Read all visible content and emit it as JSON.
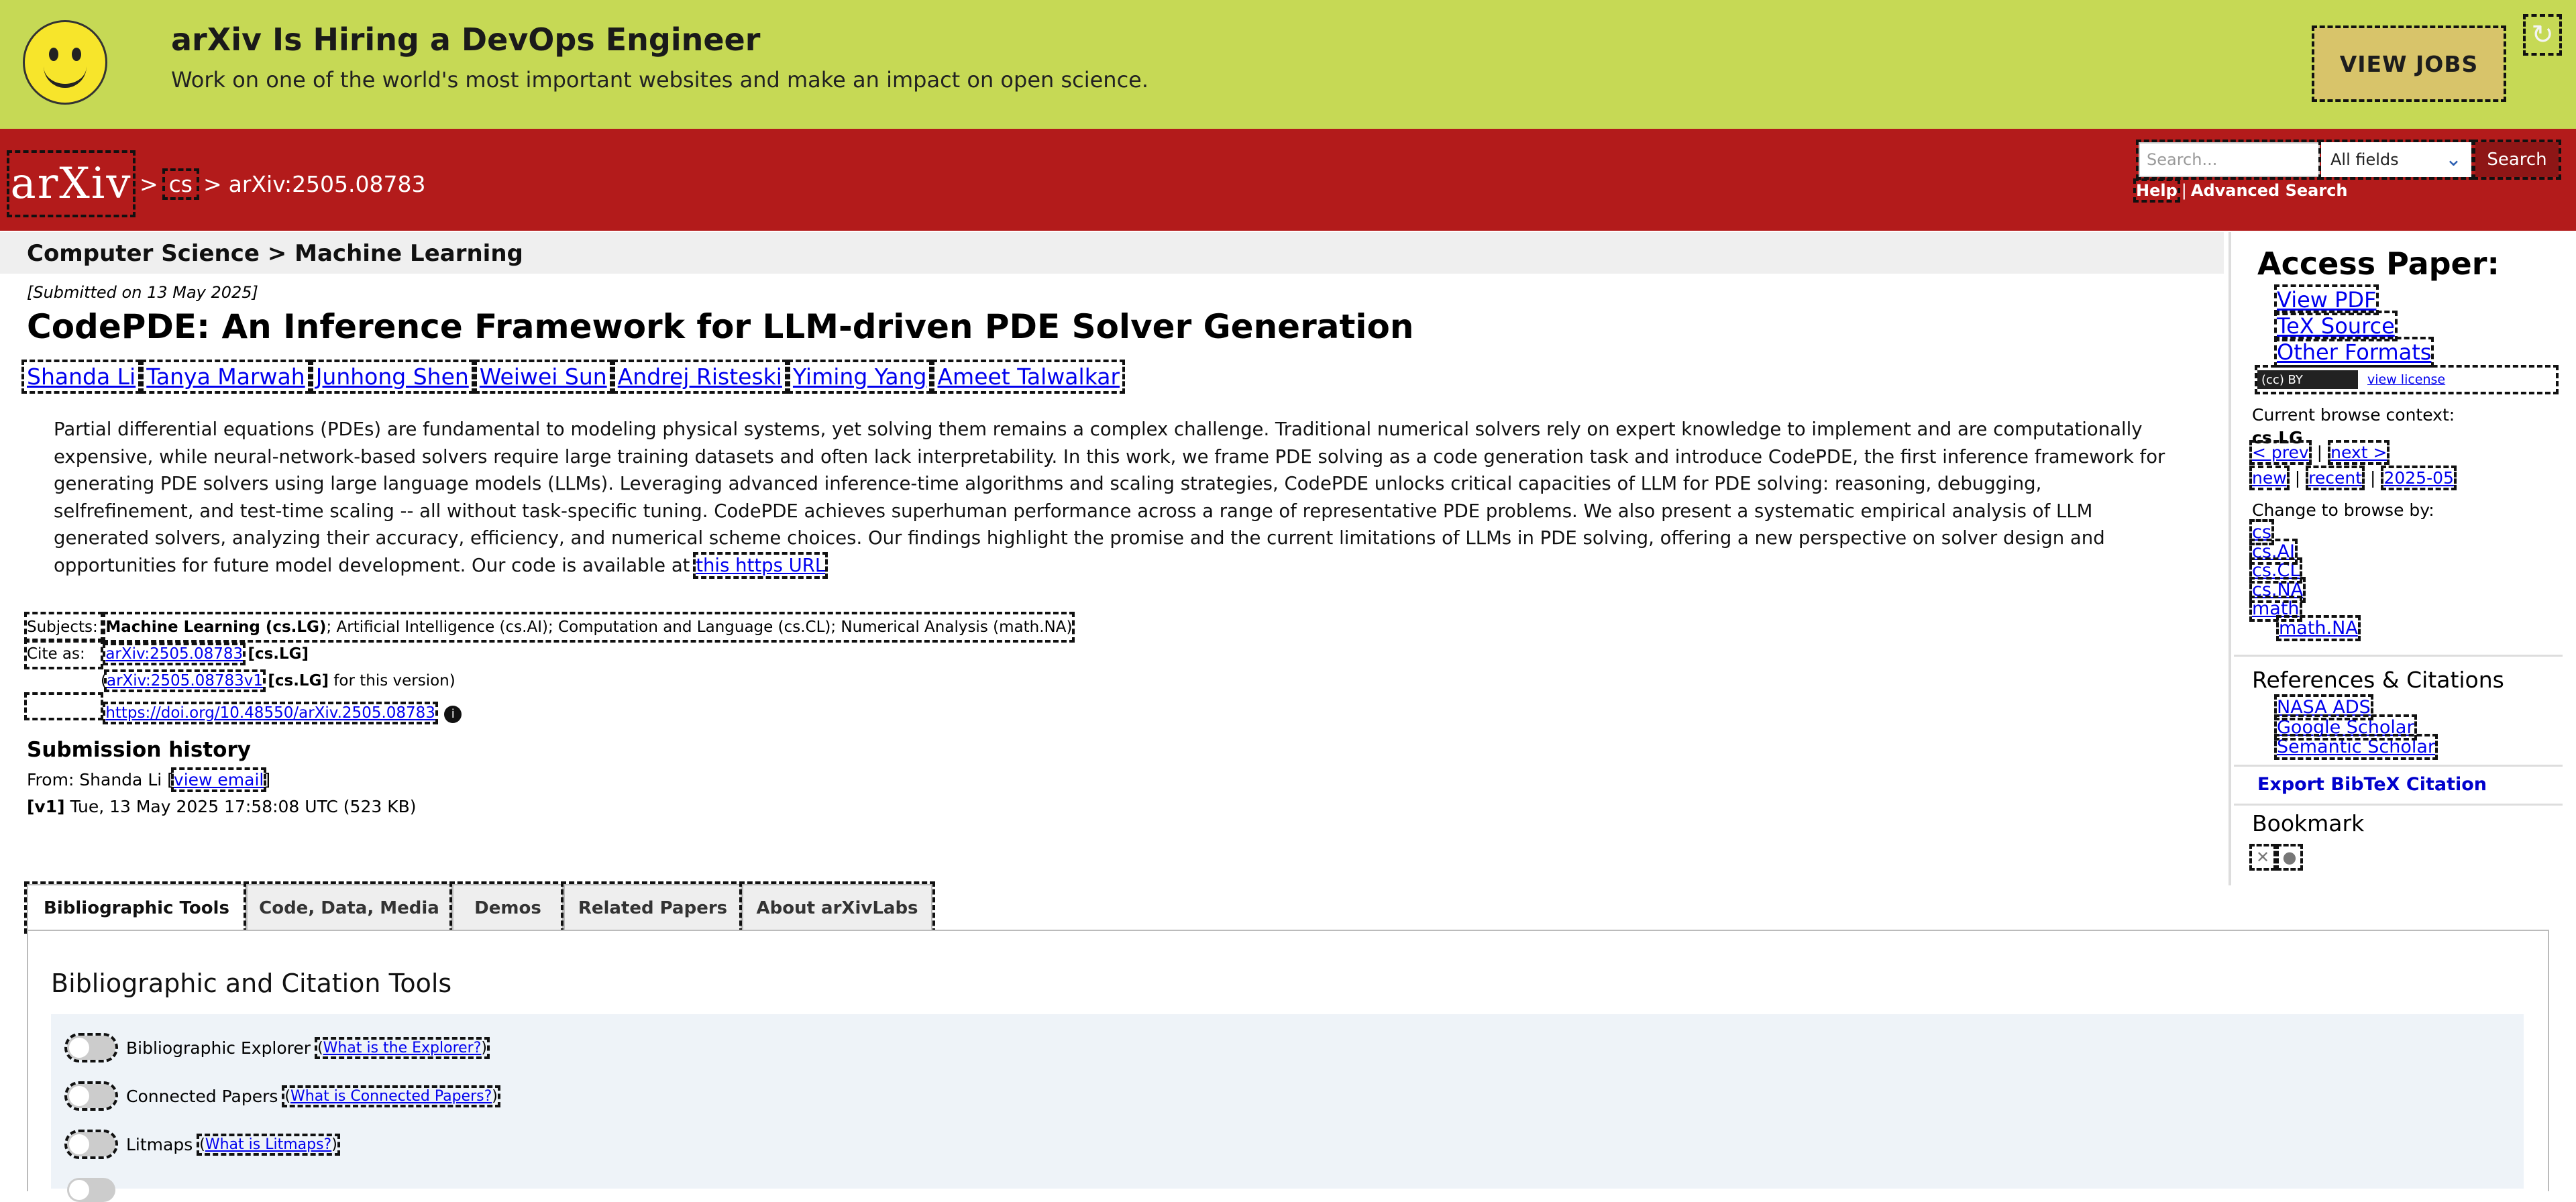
{
  "banner": {
    "title": "arXiv Is Hiring a DevOps Engineer",
    "subtitle": "Work on one of the world's most important websites and make an impact on open science.",
    "view_jobs": "VIEW JOBS",
    "close_icon": "↻",
    "background_color": "#c6d955"
  },
  "header": {
    "logo_text": "arXiv",
    "crumb_sep": ">",
    "crumb_cs": "cs",
    "crumb_id": "arXiv:2505.08783",
    "search_placeholder": "Search...",
    "field_select": "All fields",
    "search_button": "Search",
    "help": "Help",
    "help_sep": "|",
    "advanced": "Advanced Search",
    "brand_color": "#b31b1b"
  },
  "subject_bar": "Computer Science > Machine Learning",
  "paper": {
    "submitted": "[Submitted on 13 May 2025]",
    "title": "CodePDE: An Inference Framework for LLM-driven PDE Solver Generation",
    "authors": [
      "Shanda Li",
      "Tanya Marwah",
      "Junhong Shen",
      "Weiwei Sun",
      "Andrej Risteski",
      "Yiming Yang",
      "Ameet Talwalkar"
    ],
    "author_sep": ",",
    "abstract": "Partial differential equations (PDEs) are fundamental to modeling physical systems, yet solving them remains a complex challenge. Traditional numerical solvers rely on expert knowledge to implement and are computationally expensive, while neural-network-based solvers require large training datasets and often lack interpretability. In this work, we frame PDE solving as a code generation task and introduce CodePDE, the first inference framework for generating PDE solvers using large language models (LLMs). Leveraging advanced inference-time algorithms and scaling strategies, CodePDE unlocks critical capacities of LLM for PDE solving: reasoning, debugging, selfrefinement, and test-time scaling -- all without task-specific tuning. CodePDE achieves superhuman performance across a range of representative PDE problems. We also present a systematic empirical analysis of LLM generated solvers, analyzing their accuracy, efficiency, and numerical scheme choices. Our findings highlight the promise and the current limitations of LLMs in PDE solving, offering a new perspective on solver design and opportunities for future model development. Our code is available at",
    "abstract_link": "this https URL",
    "subjects_label": "Subjects:",
    "subjects_primary": "Machine Learning (cs.LG)",
    "subjects_rest": "; Artificial Intelligence (cs.AI); Computation and Language (cs.CL); Numerical Analysis (math.NA)",
    "cite_label": "Cite as:",
    "cite_id": "arXiv:2505.08783",
    "cite_cat": "[cs.LG]",
    "cite_v1": "arXiv:2505.08783v1",
    "cite_v1_cat": "[cs.LG]",
    "cite_v1_suffix": "for this version)",
    "cite_v1_prefix": "(",
    "doi": "https://doi.org/10.48550/arXiv.2505.08783",
    "info_icon": "i"
  },
  "history": {
    "title": "Submission history",
    "from": "From: Shanda Li [",
    "from_link": "view email",
    "from_close": "]",
    "v1_label": "[v1]",
    "v1_text": "Tue, 13 May 2025 17:58:08 UTC (523 KB)"
  },
  "tabs": [
    "Bibliographic Tools",
    "Code, Data, Media",
    "Demos",
    "Related Papers",
    "About arXivLabs"
  ],
  "panel": {
    "title": "Bibliographic and Citation Tools",
    "rows": [
      {
        "label": "Bibliographic Explorer",
        "link": "What is the Explorer?"
      },
      {
        "label": "Connected Papers",
        "link": "What is Connected Papers?"
      },
      {
        "label": "Litmaps",
        "link": "What is Litmaps?"
      }
    ],
    "paren_open": "(",
    "paren_close": ")"
  },
  "sidebar": {
    "access_title": "Access Paper:",
    "links": [
      "View PDF",
      "TeX Source",
      "Other Formats"
    ],
    "license_badge": "(cc) BY",
    "license_link": "view license",
    "context_label": "Current browse context:",
    "context_value": "cs.LG",
    "prev": "< prev",
    "sep": "|",
    "next": "next >",
    "new": "new",
    "recent": "recent",
    "date": "2025-05",
    "change_label": "Change to browse by:",
    "change_list": [
      "cs",
      "cs.AI",
      "cs.CL",
      "cs.NA",
      "math",
      "math.NA"
    ],
    "refs_title": "References & Citations",
    "refs": [
      "NASA ADS",
      "Google Scholar",
      "Semantic Scholar"
    ],
    "bibtex": "Export BibTeX Citation",
    "bookmark_title": "Bookmark",
    "bookmark_icons": [
      "x-icon",
      "reddit-icon"
    ],
    "bookmark_glyphs": [
      "✕",
      "●"
    ]
  }
}
